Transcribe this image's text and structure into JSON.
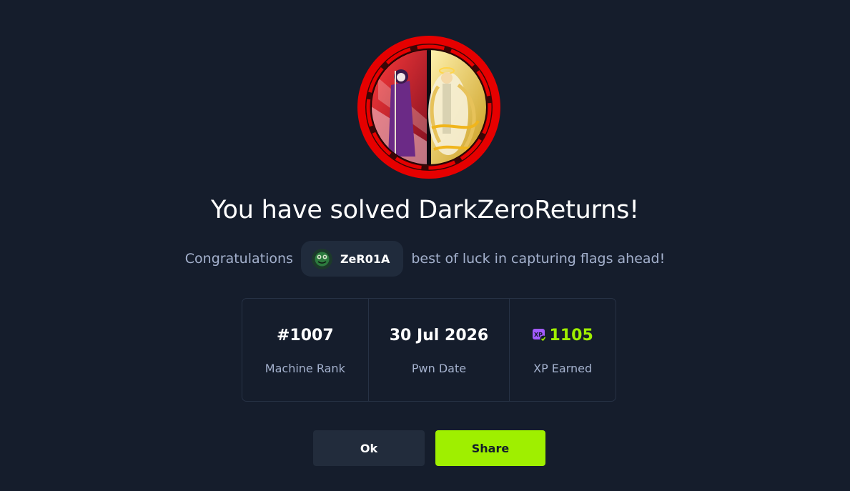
{
  "machine": {
    "badge_icon": "dark-zero-returns-badge-icon",
    "badge_ring_color": "#e60000"
  },
  "heading": {
    "title": "You have solved DarkZeroReturns!"
  },
  "congrats": {
    "prefix": "Congratulations",
    "username": "ZeR01A",
    "avatar_icon": "user-avatar-icon",
    "suffix": "best of luck in capturing flags ahead!"
  },
  "stats": {
    "rank": {
      "value": "#1007",
      "label": "Machine Rank"
    },
    "date": {
      "value": "30 Jul 2026",
      "label": "Pwn Date"
    },
    "xp": {
      "value": "1105",
      "label": "XP Earned",
      "icon": "xp-icon",
      "color": "#9fef00"
    }
  },
  "buttons": {
    "ok_label": "Ok",
    "share_label": "Share",
    "share_color": "#9fef00"
  }
}
